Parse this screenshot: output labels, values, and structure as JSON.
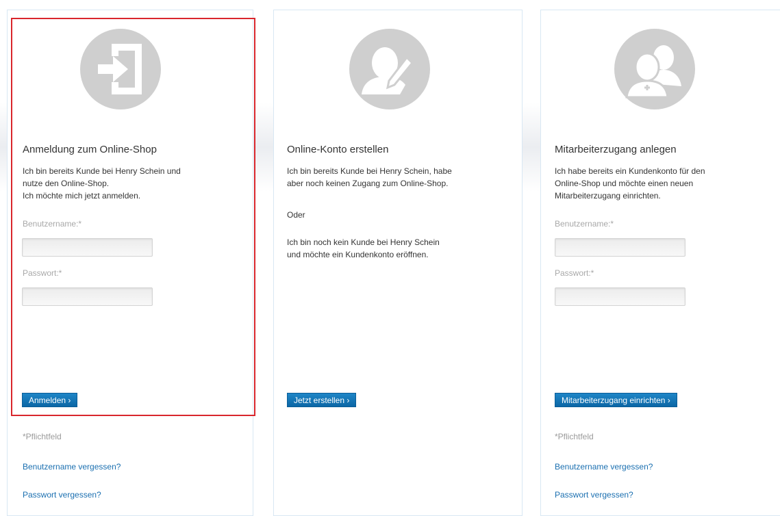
{
  "cards": [
    {
      "title": "Anmeldung zum Online-Shop",
      "description": "Ich bin bereits Kunde bei Henry Schein und\nnutze den Online-Shop.\nIch möchte mich jetzt anmelden.",
      "username_label": "Benutzername:*",
      "password_label": "Passwort:*",
      "username_value": "",
      "password_value": "",
      "button_label": "Anmelden ›",
      "required_note": "*Pflichtfeld",
      "forgot_username": "Benutzername vergessen?",
      "forgot_password": "Passwort vergessen?",
      "icon": "login-icon"
    },
    {
      "title": "Online-Konto erstellen",
      "description": "Ich bin bereits Kunde bei Henry Schein, habe\naber noch keinen Zugang zum Online-Shop.",
      "or_text": "Oder",
      "description2": "Ich bin noch kein Kunde bei Henry Schein\nund möchte ein Kundenkonto eröffnen.",
      "button_label": "Jetzt erstellen ›",
      "icon": "user-edit-icon"
    },
    {
      "title": "Mitarbeiterzugang anlegen",
      "description": "Ich habe bereits ein Kundenkonto für den\nOnline-Shop und möchte einen neuen\nMitarbeiterzugang einrichten.",
      "username_label": "Benutzername:*",
      "password_label": "Passwort:*",
      "username_value": "",
      "password_value": "",
      "button_label": "Mitarbeiterzugang einrichten ›",
      "required_note": "*Pflichtfeld",
      "forgot_username": "Benutzername vergessen?",
      "forgot_password": "Passwort vergessen?",
      "icon": "add-users-icon"
    }
  ],
  "colors": {
    "button": "#0b6fb3",
    "link": "#1a6fb0",
    "highlight_border": "#d9262c",
    "icon_circle": "#cfcfcf"
  }
}
